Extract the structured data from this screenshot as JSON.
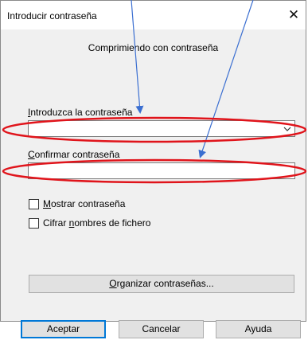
{
  "dialog": {
    "title": "Introducir contraseña",
    "close_glyph": "✕",
    "subtitle": "Comprimiendo con contraseña"
  },
  "password": {
    "label_mnemonic": "I",
    "label_rest": "ntroduzca la contraseña",
    "value": ""
  },
  "confirm": {
    "label_mnemonic": "C",
    "label_rest": "onfirmar contraseña",
    "value": ""
  },
  "options": {
    "show_password": {
      "mnemonic": "M",
      "rest": "ostrar contraseña",
      "checked": false
    },
    "encrypt_names": {
      "before": "Cifrar ",
      "mnemonic": "n",
      "after": "ombres de fichero",
      "checked": false
    }
  },
  "organize_button": {
    "mnemonic": "O",
    "rest": "rganizar contraseñas..."
  },
  "buttons": {
    "ok": "Aceptar",
    "cancel": "Cancelar",
    "help": "Ayuda"
  },
  "annotation_colors": {
    "arrow": "#3b6fd1",
    "ellipse": "#e0141b"
  },
  "icons": {
    "combo_arrow": "chevron-down-icon",
    "close": "close-icon"
  }
}
